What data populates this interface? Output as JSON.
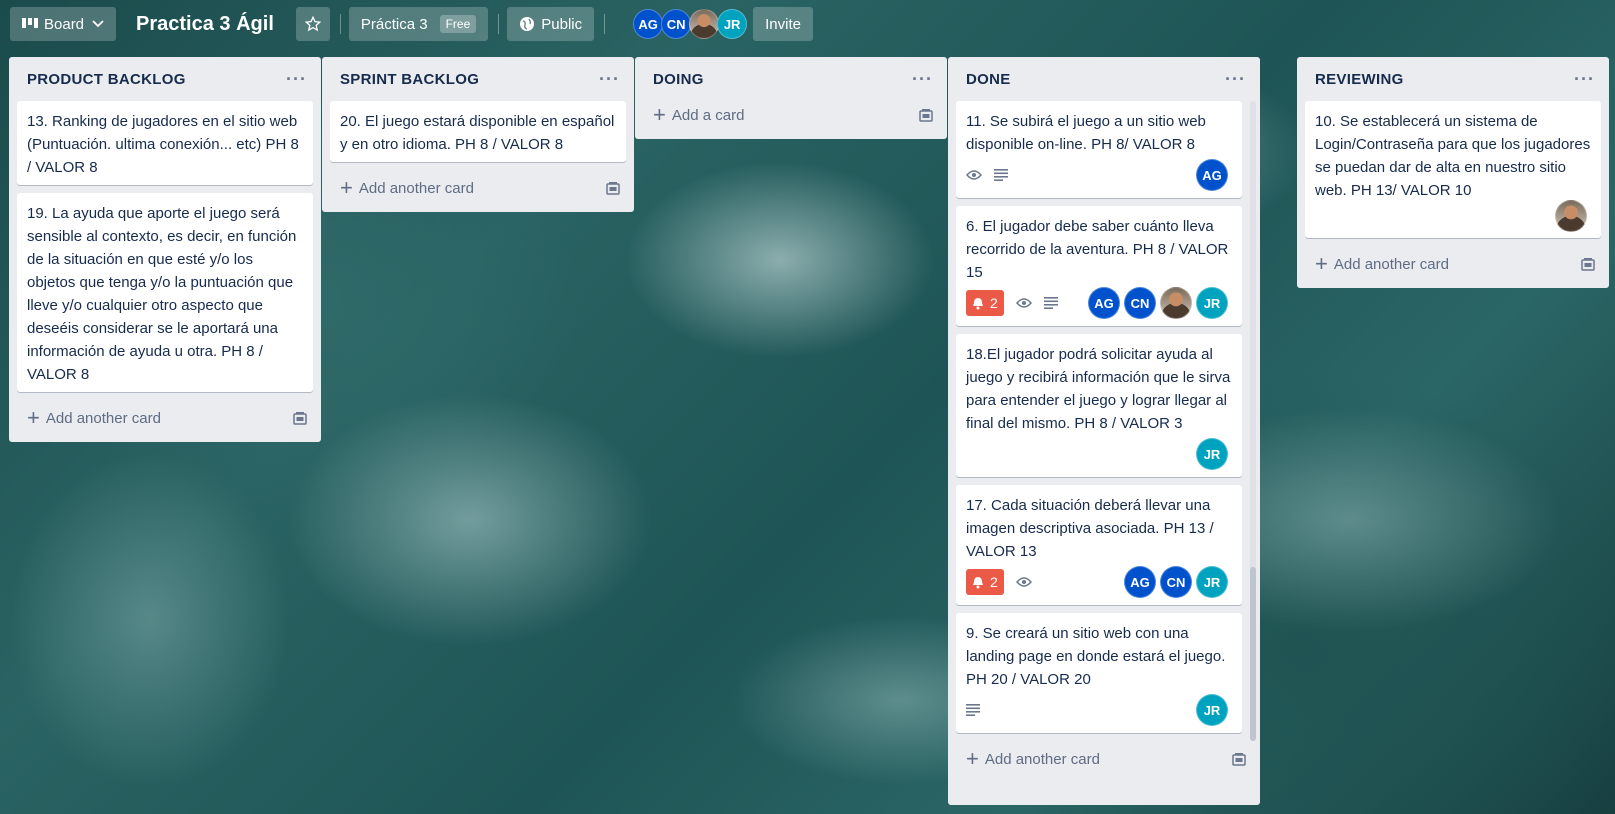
{
  "header": {
    "view_switcher": "Board",
    "board_title": "Practica 3 Ágil",
    "workspace": "Práctica 3",
    "workspace_badge": "Free",
    "visibility": "Public",
    "members": [
      "AG",
      "CN",
      "",
      "JR"
    ],
    "invite": "Invite"
  },
  "colors": {
    "ag": "#0052cc",
    "cn": "#0052cc",
    "jr": "#00a3bf",
    "due": "#eb5a46",
    "list_bg": "#ebecf0"
  },
  "lists": [
    {
      "title": "PRODUCT BACKLOG",
      "add_label": "Add another card",
      "cards": [
        {
          "text": "13. Ranking de jugadores en el sitio web (Puntuación. ultima conexión... etc) PH 8 / VALOR 8"
        },
        {
          "text": "19. La ayuda que aporte el juego será sensible al contexto, es decir, en función de la situación en que esté y/o los objetos que tenga y/o la puntuación que lleve y/o cualquier otro aspecto que deseéis considerar se le aportará una información de ayuda u otra. PH 8 / VALOR 8"
        }
      ]
    },
    {
      "title": "SPRINT BACKLOG",
      "add_label": "Add another card",
      "cards": [
        {
          "text": "20. El juego estará disponible en español y en otro idioma. PH 8 / VALOR 8"
        }
      ]
    },
    {
      "title": "DOING",
      "add_label": "Add a card",
      "cards": []
    },
    {
      "title": "DONE",
      "add_label": "Add another card",
      "cards": [
        {
          "text": "11. Se subirá el juego a un sitio web disponible on-line. PH 8/ VALOR 8",
          "badges": [
            "eye-icon",
            "description-icon"
          ],
          "members": [
            "AG"
          ]
        },
        {
          "text": "6. El jugador debe saber cuánto lleva recorrido de la aventura. PH 8 / VALOR 15",
          "due": "2",
          "badges": [
            "eye-icon",
            "description-icon"
          ],
          "members": [
            "AG",
            "CN",
            "",
            "JR"
          ]
        },
        {
          "text": "18.El jugador podrá solicitar ayuda al juego y recibirá información que le sirva para entender el juego y lograr llegar al final del mismo. PH 8 / VALOR 3",
          "members": [
            "JR"
          ]
        },
        {
          "text": "17. Cada situación deberá llevar una imagen descriptiva asociada. PH 13 / VALOR 13",
          "due": "2",
          "badges": [
            "eye-icon"
          ],
          "members": [
            "AG",
            "CN",
            "JR"
          ]
        },
        {
          "text": "9. Se creará un sitio web con una landing page en donde estará el juego. PH 20 / VALOR 20",
          "badges": [
            "description-icon"
          ],
          "members": [
            "JR"
          ]
        }
      ]
    },
    {
      "title": "REVIEWING",
      "add_label": "Add another card",
      "cards": [
        {
          "text": "10. Se establecerá un sistema de Login/Contraseña para que los jugadores se puedan dar de alta en nuestro sitio web. PH 13/ VALOR 10",
          "members": [
            ""
          ]
        }
      ]
    }
  ]
}
